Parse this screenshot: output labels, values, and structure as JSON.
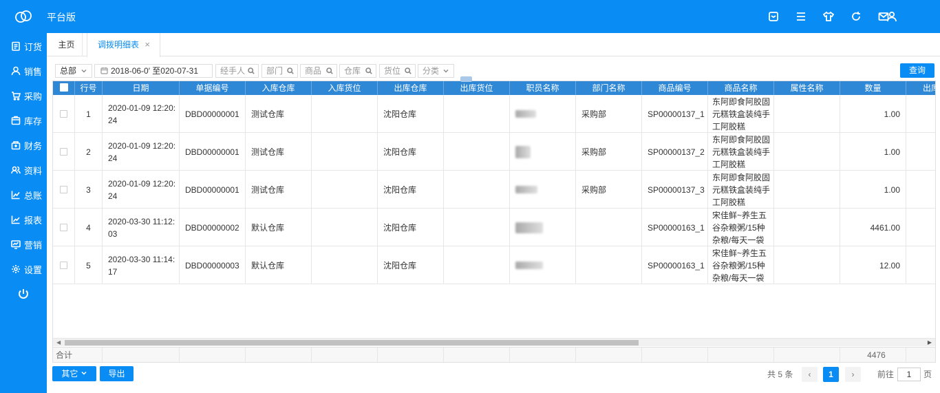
{
  "app": {
    "title": "平台版"
  },
  "topbar_icons": [
    "box-icon",
    "menu-icon",
    "shirt-icon",
    "refresh-icon",
    "mail-icon",
    "user-icon"
  ],
  "sidebar": {
    "items": [
      {
        "label": "订货",
        "icon": "clipboard-icon"
      },
      {
        "label": "销售",
        "icon": "person-icon"
      },
      {
        "label": "采购",
        "icon": "cart-icon"
      },
      {
        "label": "库存",
        "icon": "inventory-icon"
      },
      {
        "label": "财务",
        "icon": "finance-icon"
      },
      {
        "label": "资料",
        "icon": "people-icon"
      },
      {
        "label": "总账",
        "icon": "ledger-chart-icon"
      },
      {
        "label": "报表",
        "icon": "report-chart-icon"
      },
      {
        "label": "营销",
        "icon": "marketing-icon"
      },
      {
        "label": "设置",
        "icon": "gear-icon"
      }
    ],
    "power_icon": "power-icon"
  },
  "tabs": {
    "home": "主页",
    "active": "调拨明细表",
    "close": "×"
  },
  "filters": {
    "scope": "总部",
    "date_range": "2018-06-0′ 至020-07-31",
    "handler": "经手人",
    "department": "部门",
    "product": "商品",
    "warehouse": "仓库",
    "location": "货位",
    "category": "分类"
  },
  "query_button": "查询",
  "table": {
    "headers": [
      "行号",
      "日期",
      "单据编号",
      "入库仓库",
      "入库货位",
      "出库仓库",
      "出库货位",
      "职员名称",
      "部门名称",
      "商品编号",
      "商品名称",
      "属性名称",
      "数量",
      "出库"
    ],
    "rows": [
      {
        "no": "1",
        "date_a": "2020-01-09 12:20:",
        "date_b": "24",
        "doc": "DBD00000001",
        "in_wh": "测试仓库",
        "in_loc": "",
        "out_wh": "沈阳仓库",
        "out_loc": "",
        "dept": "采购部",
        "sku": "SP00000137_1",
        "name_a": "东阿即食阿胶固",
        "name_b": "元糕铁盒装纯手",
        "name_c": "工阿胶糕",
        "attr": "",
        "qty": "1.00"
      },
      {
        "no": "2",
        "date_a": "2020-01-09 12:20:",
        "date_b": "24",
        "doc": "DBD00000001",
        "in_wh": "测试仓库",
        "in_loc": "",
        "out_wh": "沈阳仓库",
        "out_loc": "",
        "dept": "采购部",
        "sku": "SP00000137_2",
        "name_a": "东阿即食阿胶固",
        "name_b": "元糕铁盒装纯手",
        "name_c": "工阿胶糕",
        "attr": "",
        "qty": "1.00"
      },
      {
        "no": "3",
        "date_a": "2020-01-09 12:20:",
        "date_b": "24",
        "doc": "DBD00000001",
        "in_wh": "测试仓库",
        "in_loc": "",
        "out_wh": "沈阳仓库",
        "out_loc": "",
        "dept": "采购部",
        "sku": "SP00000137_3",
        "name_a": "东阿即食阿胶固",
        "name_b": "元糕铁盒装纯手",
        "name_c": "工阿胶糕",
        "attr": "",
        "qty": "1.00"
      },
      {
        "no": "4",
        "date_a": "2020-03-30 11:12:",
        "date_b": "03",
        "doc": "DBD00000002",
        "in_wh": "默认仓库",
        "in_loc": "",
        "out_wh": "沈阳仓库",
        "out_loc": "",
        "dept": "",
        "sku": "SP00000163_1",
        "name_a": "宋佳鲜~养生五",
        "name_b": "谷杂粮粥/15种",
        "name_c": "杂粮/每天一袋",
        "attr": "",
        "qty": "4461.00"
      },
      {
        "no": "5",
        "date_a": "2020-03-30 11:14:",
        "date_b": "17",
        "doc": "DBD00000003",
        "in_wh": "默认仓库",
        "in_loc": "",
        "out_wh": "沈阳仓库",
        "out_loc": "",
        "dept": "",
        "sku": "SP00000163_1",
        "name_a": "宋佳鲜~养生五",
        "name_b": "谷杂粮粥/15种",
        "name_c": "杂粮/每天一袋",
        "attr": "",
        "qty": "12.00"
      }
    ],
    "footer_label": "合计",
    "footer_qty": "4476"
  },
  "bottom": {
    "other": "其它",
    "export": "导出",
    "total": "共 5 条",
    "current_page": "1",
    "goto_label": "前往",
    "goto_value": "1",
    "page_suffix": "页"
  },
  "colors": {
    "primary": "#0a8cf5",
    "header": "#2e88d6"
  }
}
